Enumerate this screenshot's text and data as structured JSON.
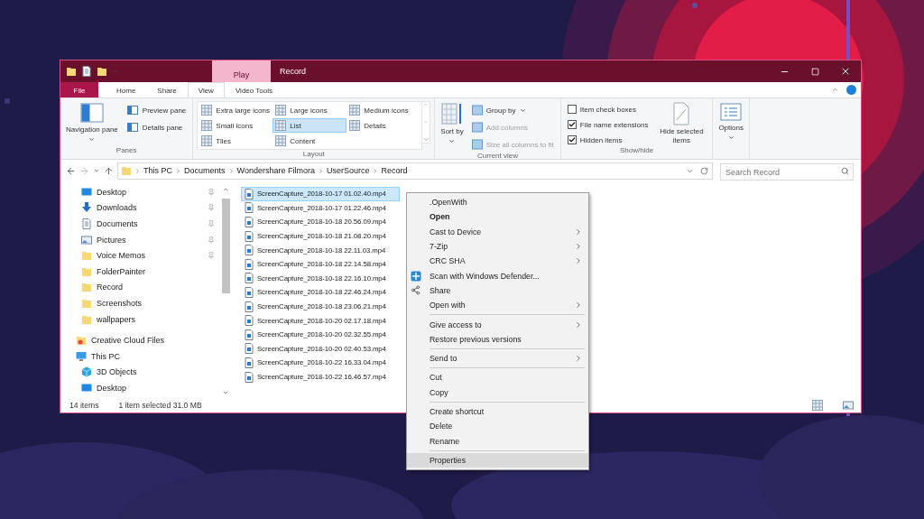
{
  "title_bar": {
    "contextual_tab": "Play",
    "title": "Record"
  },
  "ribbon_tabs": [
    {
      "label": "File",
      "kind": "file",
      "selected": false
    },
    {
      "label": "Home",
      "kind": "tab",
      "selected": false
    },
    {
      "label": "Share",
      "kind": "tab",
      "selected": false
    },
    {
      "label": "View",
      "kind": "tab",
      "selected": true
    },
    {
      "label": "Video Tools",
      "kind": "tab",
      "selected": false
    }
  ],
  "ribbon_groups": [
    {
      "kind": "panes",
      "title": "Panes",
      "big": {
        "label": "Navigation pane"
      },
      "items": [
        {
          "label": "Preview pane"
        },
        {
          "label": "Details pane"
        }
      ]
    },
    {
      "kind": "layout",
      "title": "Layout",
      "items": [
        {
          "label": "Extra large icons",
          "selected": false
        },
        {
          "label": "Large icons",
          "selected": false
        },
        {
          "label": "Medium icons",
          "selected": false
        },
        {
          "label": "Small icons",
          "selected": false
        },
        {
          "label": "List",
          "selected": true
        },
        {
          "label": "Details",
          "selected": false
        },
        {
          "label": "Tiles",
          "selected": false
        },
        {
          "label": "Content",
          "selected": false
        }
      ]
    },
    {
      "kind": "current_view",
      "title": "Current view",
      "big": {
        "label": "Sort by"
      },
      "items": [
        {
          "label": "Group by",
          "disabled": false
        },
        {
          "label": "Add columns",
          "disabled": true
        },
        {
          "label": "Size all columns to fit",
          "disabled": true
        }
      ]
    },
    {
      "kind": "show_hide",
      "title": "Show/hide",
      "big": {
        "label": "Hide selected items"
      },
      "items": [
        {
          "label": "Item check boxes",
          "checked": false
        },
        {
          "label": "File name extensions",
          "checked": true
        },
        {
          "label": "Hidden items",
          "checked": true
        }
      ]
    },
    {
      "kind": "options",
      "big": {
        "label": "Options"
      }
    }
  ],
  "address": {
    "path": [
      "This PC",
      "Documents",
      "Wondershare Filmora",
      "UserSource",
      "Record"
    ],
    "search_placeholder": "Search Record"
  },
  "nav_items": [
    {
      "label": "Desktop",
      "kind": "desktop",
      "pinned": true
    },
    {
      "label": "Downloads",
      "kind": "downloads",
      "pinned": true
    },
    {
      "label": "Documents",
      "kind": "documents",
      "pinned": true
    },
    {
      "label": "Pictures",
      "kind": "pictures",
      "pinned": true
    },
    {
      "label": "Voice Memos",
      "kind": "folder",
      "pinned": true
    },
    {
      "label": "FolderPainter",
      "kind": "folder",
      "pinned": false
    },
    {
      "label": "Record",
      "kind": "folder",
      "pinned": false
    },
    {
      "label": "Screenshots",
      "kind": "folder",
      "pinned": false
    },
    {
      "label": "wallpapers",
      "kind": "folder",
      "pinned": false
    },
    {
      "label": "Creative Cloud Files",
      "kind": "cloud",
      "pinned": false,
      "top": true
    },
    {
      "label": "This PC",
      "kind": "pc",
      "pinned": false,
      "top": true,
      "children": [
        {
          "label": "3D Objects",
          "kind": "cube",
          "pinned": false
        },
        {
          "label": "Desktop",
          "kind": "desktop",
          "pinned": false
        }
      ]
    }
  ],
  "files": [
    {
      "name": "ScreenCapture_2018-10-17 01.02.40.mp4",
      "selected": true
    },
    {
      "name": "ScreenCapture_2018-10-17 01.22.46.mp4",
      "selected": false
    },
    {
      "name": "ScreenCapture_2018-10-18 20.56.09.mp4",
      "selected": false
    },
    {
      "name": "ScreenCapture_2018-10-18 21.08.20.mp4",
      "selected": false
    },
    {
      "name": "ScreenCapture_2018-10-18 22.11.03.mp4",
      "selected": false
    },
    {
      "name": "ScreenCapture_2018-10-18 22.14.58.mp4",
      "selected": false
    },
    {
      "name": "ScreenCapture_2018-10-18 22.16.10.mp4",
      "selected": false
    },
    {
      "name": "ScreenCapture_2018-10-18 22.46.24.mp4",
      "selected": false
    },
    {
      "name": "ScreenCapture_2018-10-18 23.06.21.mp4",
      "selected": false
    },
    {
      "name": "ScreenCapture_2018-10-20 02.17.18.mp4",
      "selected": false
    },
    {
      "name": "ScreenCapture_2018-10-20 02.32.55.mp4",
      "selected": false
    },
    {
      "name": "ScreenCapture_2018-10-20 02.40.53.mp4",
      "selected": false
    },
    {
      "name": "ScreenCapture_2018-10-22 16.33.04.mp4",
      "selected": false
    },
    {
      "name": "ScreenCapture_2018-10-22 16.46.57.mp4",
      "selected": false
    }
  ],
  "context_menu": [
    [
      {
        "label": ".OpenWith",
        "bold": false,
        "submenu": false,
        "kind": "plain",
        "selected": false
      },
      {
        "label": "Open",
        "bold": true,
        "submenu": false,
        "kind": "plain",
        "selected": false
      },
      {
        "label": "Cast to Device",
        "bold": false,
        "submenu": true,
        "kind": "plain",
        "selected": false
      },
      {
        "label": "7-Zip",
        "bold": false,
        "submenu": true,
        "kind": "plain",
        "selected": false
      },
      {
        "label": "CRC SHA",
        "bold": false,
        "submenu": true,
        "kind": "plain",
        "selected": false
      },
      {
        "label": "Scan with Windows Defender...",
        "bold": false,
        "submenu": false,
        "kind": "defender",
        "selected": false
      },
      {
        "label": "Share",
        "bold": false,
        "submenu": false,
        "kind": "share",
        "selected": false
      },
      {
        "label": "Open with",
        "bold": false,
        "submenu": true,
        "kind": "plain",
        "selected": false
      }
    ],
    [
      {
        "label": "Give access to",
        "bold": false,
        "submenu": true,
        "kind": "plain",
        "selected": false
      },
      {
        "label": "Restore previous versions",
        "bold": false,
        "submenu": false,
        "kind": "plain",
        "selected": false
      }
    ],
    [
      {
        "label": "Send to",
        "bold": false,
        "submenu": true,
        "kind": "plain",
        "selected": false
      }
    ],
    [
      {
        "label": "Cut",
        "bold": false,
        "submenu": false,
        "kind": "plain",
        "selected": false
      },
      {
        "label": "Copy",
        "bold": false,
        "submenu": false,
        "kind": "plain",
        "selected": false
      }
    ],
    [
      {
        "label": "Create shortcut",
        "bold": false,
        "submenu": false,
        "kind": "plain",
        "selected": false
      },
      {
        "label": "Delete",
        "bold": false,
        "submenu": false,
        "kind": "plain",
        "selected": false
      },
      {
        "label": "Rename",
        "bold": false,
        "submenu": false,
        "kind": "plain",
        "selected": false
      }
    ],
    [
      {
        "label": "Properties",
        "bold": false,
        "submenu": false,
        "kind": "plain",
        "selected": true
      }
    ]
  ],
  "status_bar": {
    "count": "14 items",
    "selection": "1 item selected  31.0 MB"
  }
}
